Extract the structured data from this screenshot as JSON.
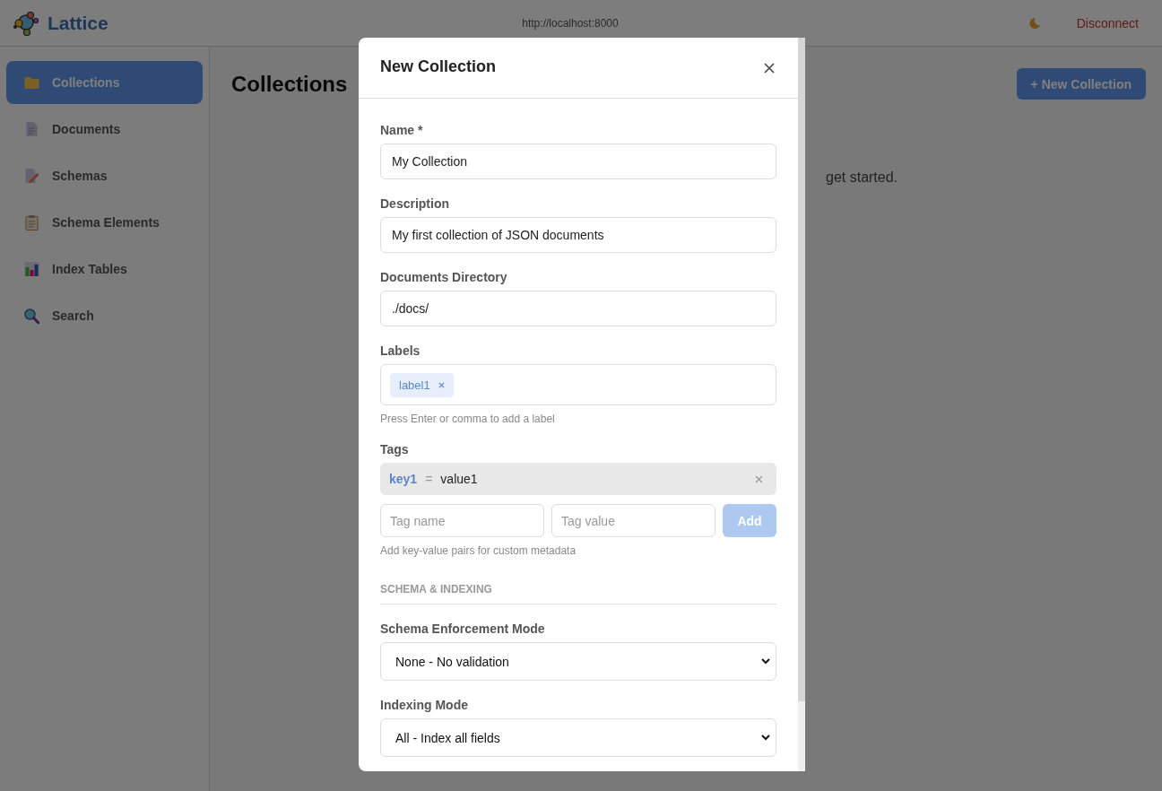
{
  "header": {
    "logo_text": "Lattice",
    "url": "http://localhost:8000",
    "action": "Disconnect"
  },
  "sidebar": {
    "items": [
      {
        "label": "Collections",
        "kind": "folder",
        "selected": true
      },
      {
        "label": "Documents",
        "kind": "document",
        "selected": false
      },
      {
        "label": "Schemas",
        "kind": "pencil-doc",
        "selected": false
      },
      {
        "label": "Schema Elements",
        "kind": "clipboard",
        "selected": false
      },
      {
        "label": "Index Tables",
        "kind": "bar-chart",
        "selected": false
      },
      {
        "label": "Search",
        "kind": "magnifier",
        "selected": false
      }
    ]
  },
  "main": {
    "title": "Collections",
    "new_button": "+ New Collection",
    "empty_text": "get started."
  },
  "modal": {
    "title": "New Collection",
    "fields": [
      {
        "kind": "text",
        "label": "Name *",
        "value": "My Collection"
      },
      {
        "kind": "text",
        "label": "Description",
        "value": "My first collection of JSON documents"
      },
      {
        "kind": "text",
        "label": "Documents Directory",
        "value": "./docs/"
      },
      {
        "kind": "chips",
        "label": "Labels",
        "chips": [
          "label1"
        ],
        "hint": "Press Enter or comma to add a label"
      },
      {
        "kind": "tags",
        "label": "Tags",
        "pairs": [
          {
            "key": "key1",
            "separator": "=",
            "value": "value1"
          }
        ],
        "name_placeholder": "Tag name",
        "value_placeholder": "Tag value",
        "add_button": "Add",
        "add_disabled": true,
        "hint": "Add key-value pairs for custom metadata"
      },
      {
        "kind": "section",
        "label": "SCHEMA & INDEXING"
      },
      {
        "kind": "select",
        "label": "Schema Enforcement Mode",
        "value": "None - No validation"
      },
      {
        "kind": "select",
        "label": "Indexing Mode",
        "value": "All - Index all fields"
      }
    ]
  }
}
